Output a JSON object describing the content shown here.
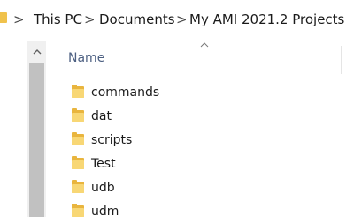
{
  "breadcrumb": {
    "items": [
      "This PC",
      "Documents",
      "My AMI 2021.2 Projects"
    ],
    "separator": ">"
  },
  "column_header": {
    "name": "Name"
  },
  "files": [
    {
      "name": "commands",
      "icon": "folder-icon"
    },
    {
      "name": "dat",
      "icon": "folder-icon"
    },
    {
      "name": "scripts",
      "icon": "folder-icon"
    },
    {
      "name": "Test",
      "icon": "folder-icon"
    },
    {
      "name": "udb",
      "icon": "folder-icon"
    },
    {
      "name": "udm",
      "icon": "folder-icon"
    }
  ],
  "colors": {
    "folder": "#f8d775",
    "header_text": "#4d6082",
    "scrollbar_thumb": "#c1c1c1"
  }
}
